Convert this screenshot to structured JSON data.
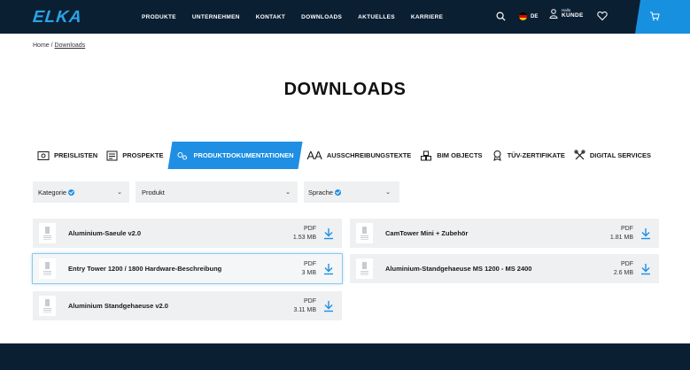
{
  "header": {
    "logo": "ELKA",
    "nav": [
      "PRODUKTE",
      "UNTERNEHMEN",
      "KONTAKT",
      "DOWNLOADS",
      "AKTUELLES",
      "KARRIERE"
    ],
    "lang": "DE",
    "user_hello": "Hallo",
    "user_name": "KUNDE",
    "brand_color": "#0b1f33",
    "accent_color": "#1f8fe3"
  },
  "breadcrumb": {
    "home": "Home /",
    "current": "Downloads"
  },
  "page_title": "DOWNLOADS",
  "tabs": [
    {
      "label": "PREISLISTEN",
      "icon": "price-list-icon",
      "active": false
    },
    {
      "label": "PROSPEKTE",
      "icon": "brochure-icon",
      "active": false
    },
    {
      "label": "PRODUKTDOKUMENTATIONEN",
      "icon": "gears-icon",
      "active": true
    },
    {
      "label": "AUSSCHREIBUNGSTEXTE",
      "icon": "text-icon",
      "glyph": "Aa",
      "active": false
    },
    {
      "label": "BIM OBJECTS",
      "icon": "cubes-icon",
      "active": false
    },
    {
      "label": "TÜV-ZERTIFIKATE",
      "icon": "certificate-icon",
      "active": false
    },
    {
      "label": "DIGITAL SERVICES",
      "icon": "tools-icon",
      "active": false
    }
  ],
  "filters": [
    {
      "label": "Kategorie",
      "checked": true
    },
    {
      "label": "Produkt",
      "checked": false
    },
    {
      "label": "Sprache",
      "checked": true
    }
  ],
  "chevron": "⌄",
  "files": [
    {
      "title": "Aluminium-Saeule v2.0",
      "type": "PDF",
      "size": "1.53 MB"
    },
    {
      "title": "CamTower Mini + Zubehör",
      "type": "PDF",
      "size": "1.81 MB"
    },
    {
      "title": "Entry Tower 1200 / 1800 Hardware-Beschreibung",
      "type": "PDF",
      "size": "3 MB"
    },
    {
      "title": "Aluminium-Standgehaeuse MS 1200 - MS 2400",
      "type": "PDF",
      "size": "2.6 MB"
    },
    {
      "title": "Aluminium Standgehaeuse v2.0",
      "type": "PDF",
      "size": "3.11 MB"
    }
  ]
}
